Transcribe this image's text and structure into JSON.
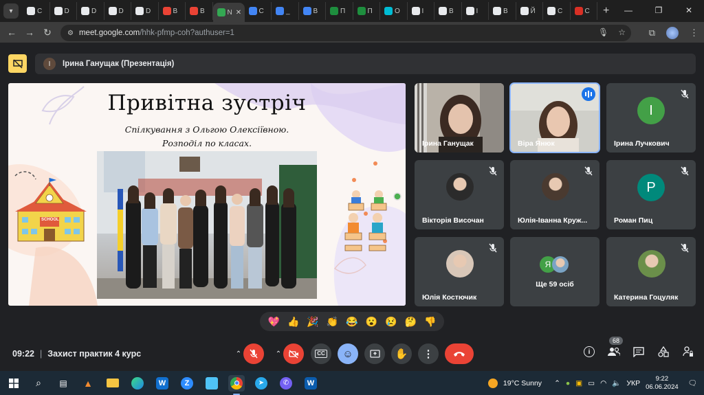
{
  "browser": {
    "tabs": [
      {
        "label": "C",
        "color": "#e8eaed"
      },
      {
        "label": "D",
        "color": "#e8eaed"
      },
      {
        "label": "D",
        "color": "#e8eaed"
      },
      {
        "label": "D",
        "color": "#e8eaed"
      },
      {
        "label": "D",
        "color": "#e8eaed"
      },
      {
        "label": "B",
        "color": "#ea4335"
      },
      {
        "label": "B",
        "color": "#ea4335"
      },
      {
        "label": "N",
        "color": "#34a853",
        "active": true
      },
      {
        "label": "C",
        "color": "#4285f4"
      },
      {
        "label": "_",
        "color": "#4285f4"
      },
      {
        "label": "B",
        "color": "#4285f4"
      },
      {
        "label": "П",
        "color": "#1e8e3e"
      },
      {
        "label": "П",
        "color": "#1e8e3e"
      },
      {
        "label": "O",
        "color": "#00bcd4"
      },
      {
        "label": "I",
        "color": "#e8eaed"
      },
      {
        "label": "B",
        "color": "#e8eaed"
      },
      {
        "label": "I",
        "color": "#e8eaed"
      },
      {
        "label": "B",
        "color": "#e8eaed"
      },
      {
        "label": "Й",
        "color": "#e8eaed"
      },
      {
        "label": "C",
        "color": "#e8eaed"
      },
      {
        "label": "C",
        "color": "#d93025"
      }
    ],
    "url_main": "meet.google.com",
    "url_rest": "/hhk-pfmp-coh?authuser=1"
  },
  "meet": {
    "presenter": {
      "initial": "І",
      "name": "Ірина Ганущак (Презентація)"
    },
    "slide": {
      "title": "Привітна зустріч",
      "subtitle_1": "Спілкування з Ольгою Олексіївною.",
      "subtitle_2": "Розподіл по класах.",
      "school_sign": "SCHOOL"
    },
    "participants": [
      {
        "name": "Ірина Ганущак",
        "kind": "video1",
        "muted": false
      },
      {
        "name": "Віра Янюк",
        "kind": "video2",
        "muted": false,
        "speaking": true
      },
      {
        "name": "Ірина Лучкович",
        "kind": "letter",
        "letter": "I",
        "color": "#43a047",
        "muted": true
      },
      {
        "name": "Вікторія Височан",
        "kind": "photo",
        "muted": true
      },
      {
        "name": "Юлія-Іванна Круж...",
        "kind": "photo",
        "muted": true
      },
      {
        "name": "Роман Пиц",
        "kind": "letter",
        "letter": "P",
        "color": "#00897b",
        "muted": true
      },
      {
        "name": "Юлія Костючик",
        "kind": "photo",
        "muted": true
      },
      {
        "name": "Ще 59 осіб",
        "kind": "more",
        "letter": "Я",
        "muted": false
      },
      {
        "name": "Катерина Гоцуляк",
        "kind": "photo",
        "muted": true
      }
    ],
    "reactions": [
      "💖",
      "👍",
      "🎉",
      "👏",
      "😂",
      "😮",
      "😢",
      "🤔",
      "👎"
    ],
    "time": "09:22",
    "meeting_title": "Захист практик 4 курс",
    "people_count": "68"
  },
  "taskbar": {
    "weather": "19°C  Sunny",
    "lang": "УКР",
    "time": "9:22",
    "date": "06.06.2024"
  }
}
